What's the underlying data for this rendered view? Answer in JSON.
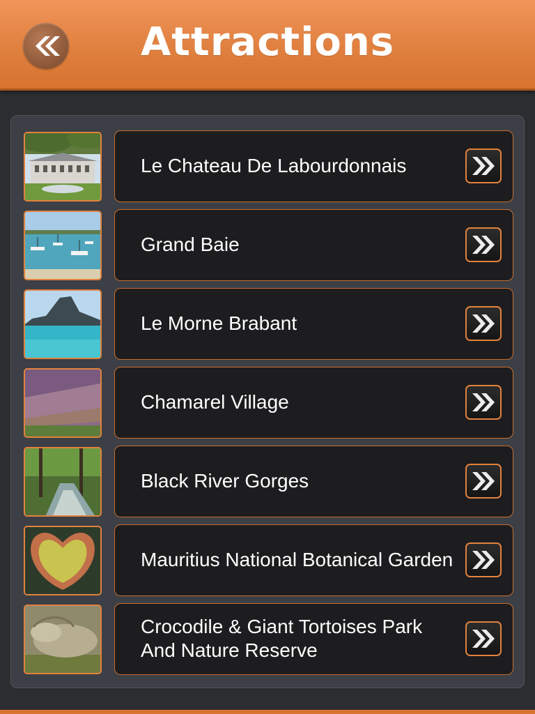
{
  "header": {
    "title": "Attractions",
    "back_icon": "double-chevron-left-icon",
    "color": "#e0803f"
  },
  "attractions": [
    {
      "label": "Le Chateau De Labourdonnais",
      "image": "chateau-photo"
    },
    {
      "label": "Grand Baie",
      "image": "bay-boats-photo"
    },
    {
      "label": "Le Morne Brabant",
      "image": "mountain-sea-photo"
    },
    {
      "label": "Chamarel Village",
      "image": "colored-earth-photo"
    },
    {
      "label": "Black River Gorges",
      "image": "forest-river-photo"
    },
    {
      "label": "Mauritius National Botanical Garden",
      "image": "water-lily-photo"
    },
    {
      "label": "Crocodile & Giant Tortoises Park And Nature Reserve",
      "image": "crocodile-photo"
    }
  ],
  "row_action_icon": "double-chevron-right-icon",
  "accent_color": "#e2823e"
}
